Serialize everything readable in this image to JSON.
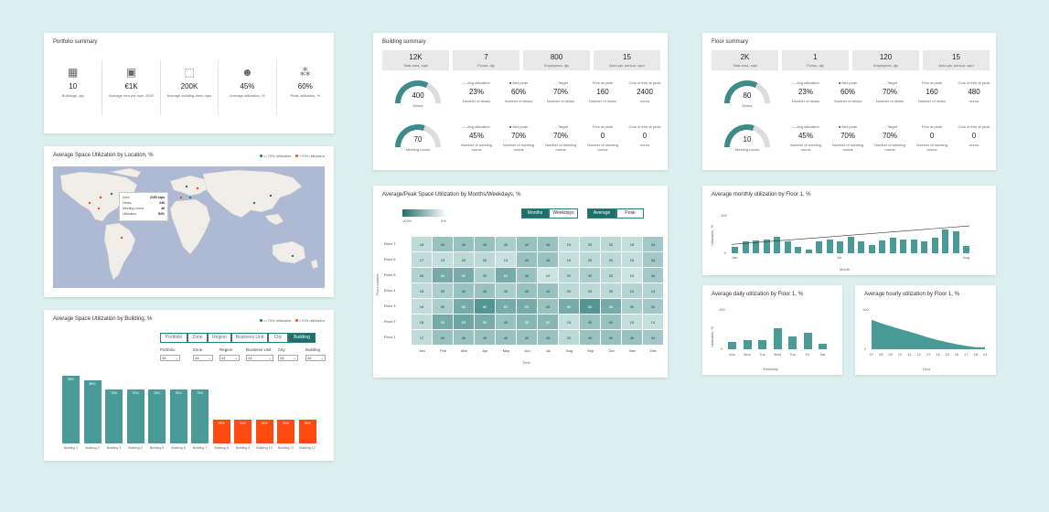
{
  "colors": {
    "teal": "#4a9b98",
    "orange": "#ff4a12",
    "dark_teal": "#1e6e6b",
    "map_water": "#aebad4",
    "map_land": "#f1eee9"
  },
  "portfolio": {
    "title": "Portfolio summary",
    "items": [
      {
        "icon": "building-icon",
        "value": "10",
        "label": "Buildings, qty"
      },
      {
        "icon": "money-icon",
        "value": "€1K",
        "label": "Average rent per sqm, EUR"
      },
      {
        "icon": "area-icon",
        "value": "200K",
        "label": "Average building area, sqm"
      },
      {
        "icon": "people-icon",
        "value": "45%",
        "label": "Average utilization, %"
      },
      {
        "icon": "crowd-icon",
        "value": "60%",
        "label": "Peak utilization, %"
      }
    ]
  },
  "location": {
    "title": "Average Space Utilization by Location, %",
    "legend": [
      {
        "label": "<=70% utilization",
        "color": "#1e7b6f"
      },
      {
        "label": ">70% utilization",
        "color": "#ff4a12"
      }
    ],
    "tooltip": [
      {
        "k": "Area",
        "v": "2150 sqm"
      },
      {
        "k": "Desks",
        "v": "240"
      },
      {
        "k": "Meeting rooms",
        "v": "46"
      },
      {
        "k": "Utilization",
        "v": "84%"
      }
    ]
  },
  "by_building": {
    "title": "Average Space Utilization by Building, %",
    "legend": [
      {
        "label": "<=70% utilization",
        "color": "#1e7b6f"
      },
      {
        "label": ">70% utilization",
        "color": "#ff4a12"
      }
    ],
    "tabs": [
      "Portfolio",
      "Zone",
      "Region",
      "Business Unit",
      "City",
      "Building"
    ],
    "filters": [
      {
        "label": "Portfolio",
        "value": "All"
      },
      {
        "label": "Zone",
        "value": "All"
      },
      {
        "label": "Region",
        "value": "All"
      },
      {
        "label": "Business Unit",
        "value": "All"
      },
      {
        "label": "City",
        "value": "All"
      },
      {
        "label": "Building",
        "value": "All"
      }
    ]
  },
  "building_summary": {
    "title": "Building summary",
    "kpis": [
      {
        "value": "12K",
        "label": "Total area, sqm"
      },
      {
        "value": "7",
        "label": "Floors, qty"
      },
      {
        "value": "800",
        "label": "Employees, qty"
      },
      {
        "value": "15",
        "label": "Area per person, sqm"
      }
    ],
    "desks": {
      "gauge_value": "400",
      "gauge_label": "Desks",
      "metrics": [
        {
          "head": "— Avg utilization",
          "value": "23%",
          "label": "Number of desks"
        },
        {
          "head": "■ Abs peak",
          "value": "60%",
          "label": "Number of desks"
        },
        {
          "head": "- - Target",
          "value": "70%",
          "label": "Number of desks"
        },
        {
          "head": "Free at peak",
          "value": "160",
          "label": "Number of desks"
        },
        {
          "head": "Cost of free at peak",
          "value": "2400",
          "label": "euros"
        }
      ]
    },
    "rooms": {
      "gauge_value": "70",
      "gauge_label": "Meeting rooms",
      "metrics": [
        {
          "head": "— Avg utilization",
          "value": "45%",
          "label": "Number of meeting rooms"
        },
        {
          "head": "■ Abs peak",
          "value": "70%",
          "label": "Number of meeting rooms"
        },
        {
          "head": "- - Target",
          "value": "70%",
          "label": "Number of meeting rooms"
        },
        {
          "head": "Free at peak",
          "value": "0",
          "label": "Number of meeting rooms"
        },
        {
          "head": "Cost of free at peak",
          "value": "0",
          "label": "euros"
        }
      ]
    }
  },
  "floor_summary": {
    "title": "Floor summary",
    "kpis": [
      {
        "value": "2K",
        "label": "Total area, sqm"
      },
      {
        "value": "1",
        "label": "Floors, qty"
      },
      {
        "value": "120",
        "label": "Employees, qty"
      },
      {
        "value": "15",
        "label": "Area per person, sqm"
      }
    ],
    "desks": {
      "gauge_value": "80",
      "gauge_label": "Desks",
      "metrics": [
        {
          "head": "— Avg utilization",
          "value": "23%",
          "label": "Number of desks"
        },
        {
          "head": "■ Abs peak",
          "value": "60%",
          "label": "Number of desks"
        },
        {
          "head": "- - Target",
          "value": "70%",
          "label": "Number of desks"
        },
        {
          "head": "Free at peak",
          "value": "160",
          "label": "Number of desks"
        },
        {
          "head": "Cost of free at peak",
          "value": "480",
          "label": "euros"
        }
      ]
    },
    "rooms": {
      "gauge_value": "10",
      "gauge_label": "Meeting rooms",
      "metrics": [
        {
          "head": "— Avg utilization",
          "value": "45%",
          "label": "Number of meeting rooms"
        },
        {
          "head": "■ Abs peak",
          "value": "70%",
          "label": "Number of meeting rooms"
        },
        {
          "head": "- - Target",
          "value": "70%",
          "label": "Number of meeting rooms"
        },
        {
          "head": "Free at peak",
          "value": "0",
          "label": "Number of meeting rooms"
        },
        {
          "head": "Cost of free at peak",
          "value": "0",
          "label": "euros"
        }
      ]
    }
  },
  "heatmap_card": {
    "title": "Average/Peak Space Utilization by Months/Weekdays, %",
    "scale_min": "100%",
    "scale_max": "0%",
    "toggle1": [
      "Months",
      "Weekdays"
    ],
    "toggle2": [
      "Average",
      "Peak"
    ],
    "ylabel": "Floor number",
    "xlabel": "Time"
  },
  "monthly_card": {
    "title": "Average monthly utilization by Floor 1, %",
    "ylabel": "Utilization, %",
    "xlabel": "Month"
  },
  "daily_card": {
    "title": "Average daily utilization by Floor 1, %",
    "ylabel": "Utilization, %",
    "xlabel": "Weekday"
  },
  "hourly_card": {
    "title": "Average hourly utilization by Floor 1, %",
    "xlabel": "Hour"
  },
  "chart_data": [
    {
      "type": "bar",
      "id": "by_building",
      "categories": [
        "Building 1",
        "Building 2",
        "Building 3",
        "Building 4",
        "Building 5",
        "Building 6",
        "Building 7",
        "Building 8",
        "Building 9",
        "Building 10",
        "Building 11",
        "Building 12"
      ],
      "values": [
        95,
        88,
        76,
        76,
        76,
        76,
        76,
        33,
        33,
        33,
        33,
        33
      ],
      "labels": [
        "95%",
        "88%",
        "76%",
        "76%",
        "76%",
        "76%",
        "76%",
        "33%",
        "33%",
        "33%",
        "33%",
        "33%"
      ],
      "colors": [
        "#4a9b98",
        "#4a9b98",
        "#4a9b98",
        "#4a9b98",
        "#4a9b98",
        "#4a9b98",
        "#4a9b98",
        "#ff4a12",
        "#ff4a12",
        "#ff4a12",
        "#ff4a12",
        "#ff4a12"
      ],
      "ylim": [
        0,
        100
      ]
    },
    {
      "type": "heatmap",
      "id": "heatmap",
      "x": [
        "Jan",
        "Feb",
        "Mar",
        "Apr",
        "May",
        "Jun",
        "Jul",
        "Aug",
        "Sep",
        "Oct",
        "Nov",
        "Dec"
      ],
      "y": [
        "Floor 7",
        "Floor 6",
        "Floor 5",
        "Floor 4",
        "Floor 3",
        "Floor 2",
        "Floor 1"
      ],
      "values": [
        [
          18,
          40,
          40,
          40,
          30,
          40,
          40,
          15,
          20,
          20,
          15,
          34
        ],
        [
          17,
          15,
          20,
          20,
          13,
          40,
          40,
          15,
          20,
          20,
          15,
          34
        ],
        [
          26,
          60,
          60,
          30,
          60,
          40,
          10,
          20,
          30,
          20,
          10,
          34
        ],
        [
          18,
          30,
          40,
          40,
          30,
          40,
          40,
          20,
          20,
          20,
          24,
          24
        ],
        [
          16,
          30,
          60,
          80,
          60,
          60,
          40,
          60,
          80,
          60,
          30,
          34
        ],
        [
          18,
          60,
          65,
          60,
          40,
          50,
          50,
          15,
          40,
          40,
          15,
          14
        ],
        [
          17,
          40,
          40,
          40,
          40,
          40,
          40,
          20,
          40,
          40,
          40,
          34
        ]
      ],
      "xlabel": "Time",
      "ylabel": "Floor number"
    },
    {
      "type": "bar",
      "id": "monthly",
      "categories": [
        "Jan",
        "Jan2",
        "Feb",
        "Feb2",
        "Mar",
        "Mar2",
        "Apr",
        "Apr2",
        "May",
        "May2",
        "Jun",
        "Jun2",
        "Jul",
        "Jul2",
        "Aug",
        "Aug2",
        "Sep",
        "Sep2",
        "Oct",
        "Oct2",
        "Nov",
        "Nov2",
        "Dec"
      ],
      "tick_labels": [
        "Jan",
        "Jul",
        "Aug"
      ],
      "values": [
        15,
        30,
        32,
        33,
        40,
        30,
        15,
        10,
        30,
        35,
        30,
        40,
        30,
        20,
        32,
        38,
        35,
        35,
        30,
        38,
        58,
        55,
        18
      ],
      "trend": [
        22,
        68
      ],
      "ylim": [
        0,
        100
      ],
      "yticks": [
        "0",
        "100"
      ]
    },
    {
      "type": "bar",
      "id": "daily",
      "categories": [
        "Sun",
        "Mon",
        "Tue",
        "Wed",
        "Thu",
        "Fri",
        "Sat"
      ],
      "values": [
        18,
        22,
        22,
        50,
        30,
        40,
        12
      ],
      "ylim": [
        0,
        100
      ],
      "yticks": [
        "0",
        "100"
      ]
    },
    {
      "type": "area",
      "id": "hourly",
      "x": [
        "07",
        "08",
        "09",
        "10",
        "11",
        "12",
        "13",
        "14",
        "15",
        "16",
        "17",
        "18",
        "19"
      ],
      "values": [
        70,
        62,
        55,
        48,
        42,
        35,
        28,
        22,
        17,
        12,
        8,
        5,
        5
      ],
      "ylim": [
        0,
        100
      ],
      "yticks": [
        "0",
        "100"
      ]
    }
  ]
}
